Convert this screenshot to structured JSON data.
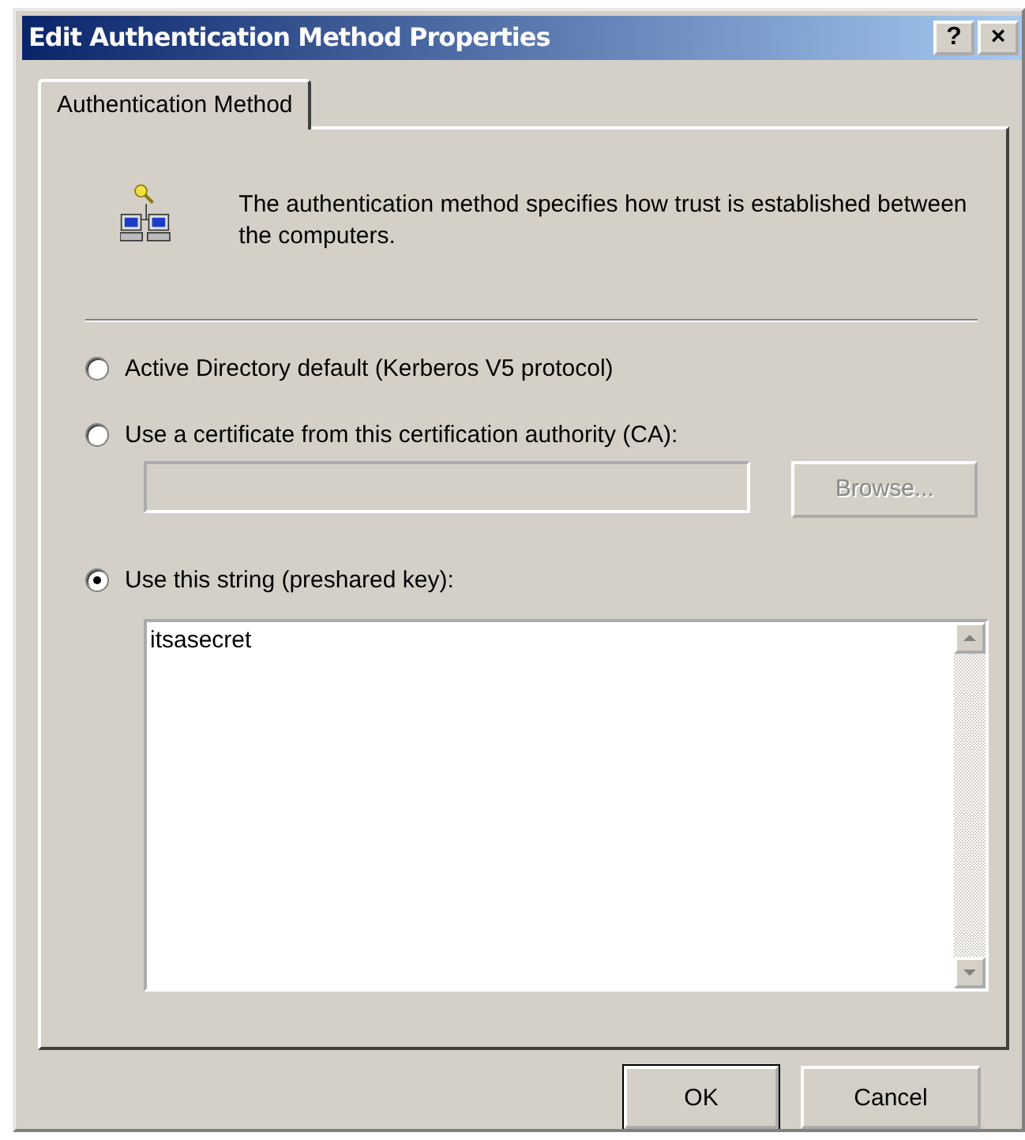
{
  "window": {
    "title": "Edit Authentication Method Properties",
    "help_button": "?",
    "close_button": "×"
  },
  "tabs": [
    {
      "label": "Authentication Method",
      "selected": true
    }
  ],
  "description": "The authentication method specifies how trust is established between the computers.",
  "options": [
    {
      "label": "Active Directory default (Kerberos V5 protocol)",
      "selected": false
    },
    {
      "label": "Use a certificate from this certification authority (CA):",
      "selected": false,
      "field": {
        "disabled": true
      },
      "button": {
        "label": "Browse...",
        "disabled": true
      }
    },
    {
      "label": "Use this string (preshared key):",
      "selected": true,
      "text_area": {
        "value": "itsasecret"
      }
    }
  ],
  "buttons": [
    {
      "label": "OK",
      "default": true
    },
    {
      "label": "Cancel",
      "default": false
    }
  ]
}
